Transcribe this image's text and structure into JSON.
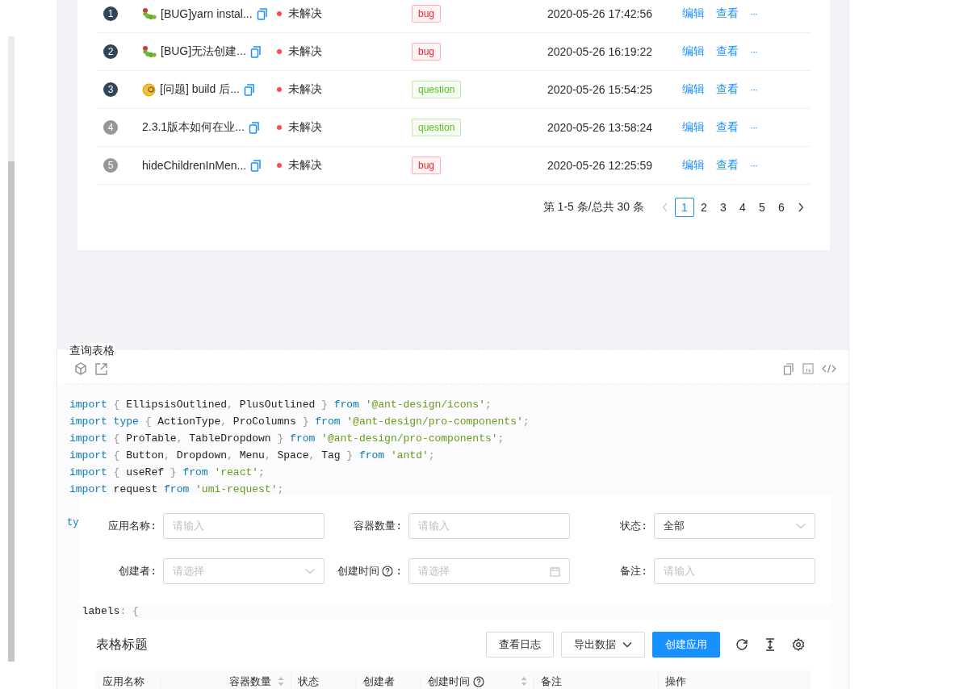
{
  "issues": {
    "rows": [
      {
        "index": "1",
        "highlighted": true,
        "kind": "caterpillar",
        "title": "[BUG]yarn instal...",
        "status": {
          "text": "未解决",
          "color": "#ff4d4f"
        },
        "tag": {
          "text": "bug",
          "color": "#f5222d"
        },
        "time": "2020-05-26 17:42:56",
        "actions": [
          "编辑",
          "查看",
          "···"
        ]
      },
      {
        "index": "2",
        "highlighted": true,
        "kind": "caterpillar",
        "title": "[BUG]无法创建...",
        "status": {
          "text": "未解决",
          "color": "#ff4d4f"
        },
        "tag": {
          "text": "bug",
          "color": "#f5222d"
        },
        "time": "2020-05-26 16:19:22",
        "actions": [
          "编辑",
          "查看",
          "···"
        ]
      },
      {
        "index": "3",
        "highlighted": true,
        "kind": "monocle",
        "title": "[问题] build 后...",
        "status": {
          "text": "未解决",
          "color": "#ff4d4f"
        },
        "tag": {
          "text": "question",
          "color": "#52c41a"
        },
        "time": "2020-05-26 15:54:25",
        "actions": [
          "编辑",
          "查看",
          "···"
        ]
      },
      {
        "index": "4",
        "highlighted": false,
        "kind": "plain",
        "title": "2.3.1版本如何在业...",
        "status": {
          "text": "未解决",
          "color": "#ff4d4f"
        },
        "tag": {
          "text": "question",
          "color": "#52c41a"
        },
        "time": "2020-05-26 13:58:24",
        "actions": [
          "编辑",
          "查看",
          "···"
        ]
      },
      {
        "index": "5",
        "highlighted": false,
        "kind": "plain",
        "title": "hideChildrenInMen...",
        "status": {
          "text": "未解决",
          "color": "#ff4d4f"
        },
        "tag": {
          "text": "bug",
          "color": "#f5222d"
        },
        "time": "2020-05-26 12:25:59",
        "actions": [
          "编辑",
          "查看",
          "···"
        ]
      }
    ],
    "pagination": {
      "total": "第 1-5 条/总共 30 条",
      "prev_disabled": true,
      "pages": [
        {
          "label": "1",
          "selected": true
        },
        {
          "label": "2",
          "selected": false
        },
        {
          "label": "3",
          "selected": false
        },
        {
          "label": "4",
          "selected": false
        },
        {
          "label": "5",
          "selected": false
        },
        {
          "label": "6",
          "selected": false
        }
      ]
    }
  },
  "demo": {
    "title": "查询表格",
    "code": {
      "lines": [
        [
          {
            "text": "import",
            "kind": "keyword"
          },
          {
            "text": " { ",
            "kind": "punct"
          },
          {
            "text": "EllipsisOutlined",
            "kind": "plain"
          },
          {
            "text": ", ",
            "kind": "punct"
          },
          {
            "text": "PlusOutlined",
            "kind": "plain"
          },
          {
            "text": " } ",
            "kind": "punct"
          },
          {
            "text": "from ",
            "kind": "keyword"
          },
          {
            "text": "'@ant-design/icons'",
            "kind": "string"
          },
          {
            "text": ";",
            "kind": "punct"
          }
        ],
        [
          {
            "text": "import ",
            "kind": "keyword"
          },
          {
            "text": "type",
            "kind": "keyword"
          },
          {
            "text": " { ",
            "kind": "punct"
          },
          {
            "text": "ActionType",
            "kind": "plain"
          },
          {
            "text": ", ",
            "kind": "punct"
          },
          {
            "text": "ProColumns",
            "kind": "plain"
          },
          {
            "text": " } ",
            "kind": "punct"
          },
          {
            "text": "from ",
            "kind": "keyword"
          },
          {
            "text": "'@ant-design/pro-components'",
            "kind": "string"
          },
          {
            "text": ";",
            "kind": "punct"
          }
        ],
        [
          {
            "text": "import",
            "kind": "keyword"
          },
          {
            "text": " { ",
            "kind": "punct"
          },
          {
            "text": "ProTable",
            "kind": "plain"
          },
          {
            "text": ", ",
            "kind": "punct"
          },
          {
            "text": "TableDropdown",
            "kind": "plain"
          },
          {
            "text": " } ",
            "kind": "punct"
          },
          {
            "text": "from ",
            "kind": "keyword"
          },
          {
            "text": "'@ant-design/pro-components'",
            "kind": "string"
          },
          {
            "text": ";",
            "kind": "punct"
          }
        ],
        [
          {
            "text": "import",
            "kind": "keyword"
          },
          {
            "text": " { ",
            "kind": "punct"
          },
          {
            "text": "Button",
            "kind": "plain"
          },
          {
            "text": ", ",
            "kind": "punct"
          },
          {
            "text": "Dropdown",
            "kind": "plain"
          },
          {
            "text": ", ",
            "kind": "punct"
          },
          {
            "text": "Menu",
            "kind": "plain"
          },
          {
            "text": ", ",
            "kind": "punct"
          },
          {
            "text": "Space",
            "kind": "plain"
          },
          {
            "text": ", ",
            "kind": "punct"
          },
          {
            "text": "Tag",
            "kind": "plain"
          },
          {
            "text": " } ",
            "kind": "punct"
          },
          {
            "text": "from ",
            "kind": "keyword"
          },
          {
            "text": "'antd'",
            "kind": "string"
          },
          {
            "text": ";",
            "kind": "punct"
          }
        ],
        [
          {
            "text": "import",
            "kind": "keyword"
          },
          {
            "text": " { ",
            "kind": "punct"
          },
          {
            "text": "useRef",
            "kind": "plain"
          },
          {
            "text": " } ",
            "kind": "punct"
          },
          {
            "text": "from ",
            "kind": "keyword"
          },
          {
            "text": "'react'",
            "kind": "string"
          },
          {
            "text": ";",
            "kind": "punct"
          }
        ],
        [
          {
            "text": "import",
            "kind": "keyword"
          },
          {
            "text": " request ",
            "kind": "plain"
          },
          {
            "text": "from ",
            "kind": "keyword"
          },
          {
            "text": "'umi-request'",
            "kind": "string"
          },
          {
            "text": ";",
            "kind": "punct"
          }
        ]
      ],
      "partial_line": [
        {
          "text": "ty",
          "kind": "keyword"
        }
      ],
      "line_after": [
        {
          "text": "  labels",
          "kind": "plain"
        },
        {
          "text": ": {",
          "kind": "punct"
        }
      ]
    }
  },
  "search_form": {
    "fields": [
      {
        "label": "应用名称:",
        "kind": "input",
        "placeholder": "请输入",
        "help": false
      },
      {
        "label": "容器数量:",
        "kind": "input",
        "placeholder": "请输入",
        "help": false
      },
      {
        "label": "状态:",
        "kind": "select",
        "value": "全部",
        "help": false
      },
      {
        "label": "创建者:",
        "kind": "select",
        "placeholder": "请选择",
        "help": false
      },
      {
        "label": "创建时间",
        "kind": "date",
        "placeholder": "请选择",
        "help": true,
        "suffix": ":"
      },
      {
        "label": "备注:",
        "kind": "input",
        "placeholder": "请输入",
        "help": false
      }
    ]
  },
  "pro_table": {
    "title": "表格标题",
    "buttons": [
      {
        "label": "查看日志",
        "kind": "default"
      },
      {
        "label": "导出数据",
        "kind": "dropdown"
      },
      {
        "label": "创建应用",
        "kind": "primary"
      }
    ],
    "columns": [
      {
        "label": "应用名称",
        "sortable": false,
        "help": false,
        "kind": "text"
      },
      {
        "label": "容器数量",
        "sortable": true,
        "help": false,
        "kind": "number"
      },
      {
        "label": "状态",
        "sortable": false,
        "help": false,
        "kind": "text"
      },
      {
        "label": "创建者",
        "sortable": false,
        "help": false,
        "kind": "text"
      },
      {
        "label": "创建时间",
        "sortable": true,
        "help": true,
        "kind": "text"
      },
      {
        "label": "备注",
        "sortable": false,
        "help": false,
        "kind": "text"
      },
      {
        "label": "操作",
        "sortable": false,
        "help": false,
        "kind": "text"
      }
    ]
  }
}
